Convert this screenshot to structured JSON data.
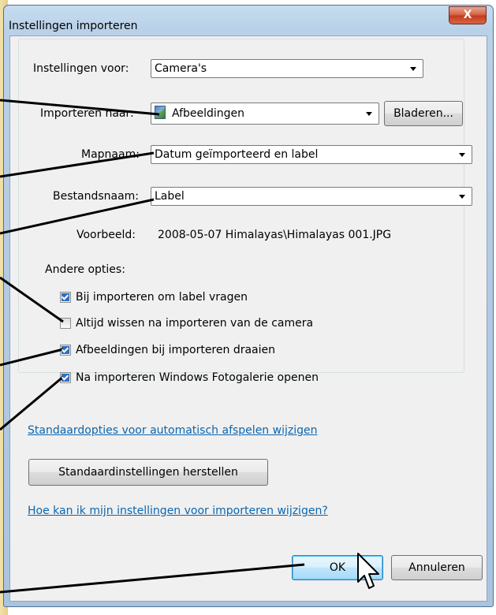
{
  "window": {
    "title": "Instellingen importeren",
    "close_glyph": "X"
  },
  "form": {
    "settings_for_label": "Instellingen voor:",
    "settings_for_value": "Camera's",
    "import_to_label": "Importeren naar:",
    "import_to_value": "Afbeeldingen",
    "import_to_icon": "pictures-folder-icon",
    "browse_label": "Bladeren...",
    "folder_name_label": "Mapnaam:",
    "folder_name_value": "Datum geïmporteerd en label",
    "file_name_label": "Bestandsnaam:",
    "file_name_value": "Label",
    "example_label": "Voorbeeld:",
    "example_value": "2008-05-07 Himalayas\\Himalayas 001.JPG"
  },
  "other_options": {
    "heading": "Andere opties:",
    "items": [
      {
        "label": "Bij importeren om label vragen",
        "checked": true
      },
      {
        "label": "Altijd wissen na importeren van de camera",
        "checked": false
      },
      {
        "label": "Afbeeldingen bij importeren draaien",
        "checked": true
      },
      {
        "label": "Na importeren Windows Fotogalerie openen",
        "checked": true
      }
    ]
  },
  "links": {
    "autoplay": "Standaardopties voor automatisch afspelen wijzigen",
    "help": "Hoe kan ik mijn instellingen voor importeren wijzigen?"
  },
  "buttons": {
    "restore_defaults": "Standaardinstellingen herstellen",
    "ok": "OK",
    "cancel": "Annuleren"
  },
  "colors": {
    "link": "#0b66b0",
    "close_button": "#c13a1c",
    "checkbox_checked": "#2f6ec4"
  }
}
